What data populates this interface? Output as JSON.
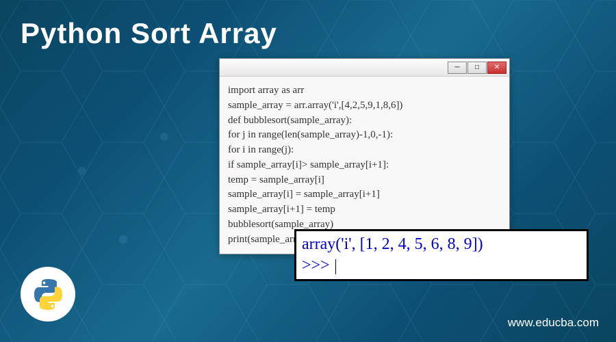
{
  "title": "Python Sort Array",
  "website": "www.educba.com",
  "code_window": {
    "lines": [
      "import array as arr",
      "sample_array = arr.array('i',[4,2,5,9,1,8,6])",
      "def bubblesort(sample_array):",
      "for j in range(len(sample_array)-1,0,-1):",
      "for i in range(j):",
      "if sample_array[i]> sample_array[i+1]:",
      "temp = sample_array[i]",
      "sample_array[i] = sample_array[i+1]",
      "sample_array[i+1] = temp",
      "bubblesort(sample_array)",
      "print(sample_array)"
    ],
    "buttons": {
      "minimize": "─",
      "maximize": "□",
      "close": "✕"
    }
  },
  "output_window": {
    "result": "array('i', [1, 2, 4, 5, 6, 8, 9])",
    "prompt": ">>>"
  }
}
